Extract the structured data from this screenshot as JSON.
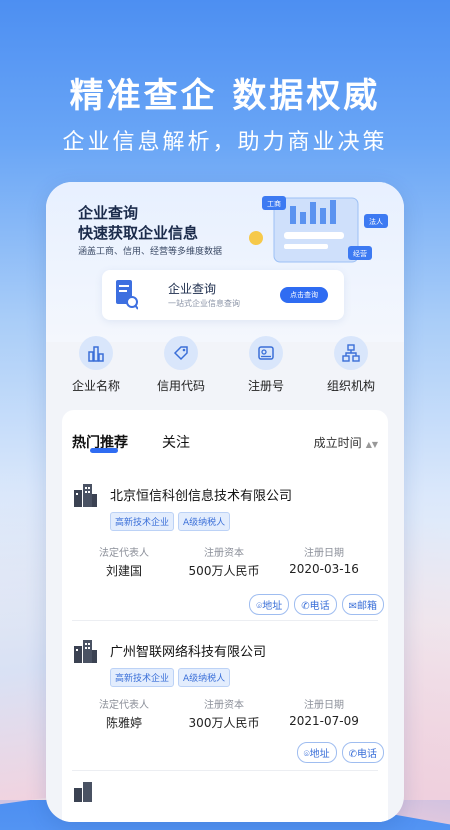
{
  "hero": {
    "title": "精准查企 数据权威",
    "subtitle": "企业信息解析，助力商业决策"
  },
  "banner": {
    "line1": "企业查询",
    "line2": "快速获取企业信息",
    "line3": "涵盖工商、信用、经营等多维度数据",
    "illus_labels": [
      "工商",
      "法人",
      "经营"
    ]
  },
  "search_card": {
    "title": "企业查询",
    "desc": "一站式企业信息查询",
    "button": "点击查询"
  },
  "categories": [
    {
      "label": "企业名称",
      "icon": "building-chart-icon"
    },
    {
      "label": "信用代码",
      "icon": "tag-icon"
    },
    {
      "label": "注册号",
      "icon": "id-card-icon"
    },
    {
      "label": "组织机构",
      "icon": "org-tree-icon"
    }
  ],
  "tabs": {
    "hot": "热门推荐",
    "follow": "关注",
    "sort": "成立时间"
  },
  "fields": {
    "legal": "法定代表人",
    "capital": "注册资本",
    "date": "注册日期"
  },
  "companies": [
    {
      "name": "北京恒信科创信息技术有限公司",
      "tags": [
        "高新技术企业",
        "A级纳税人"
      ],
      "legal": "刘建国",
      "capital": "500万人民币",
      "date": "2020-03-16",
      "actions": [
        "地址",
        "电话",
        "邮箱"
      ]
    },
    {
      "name": "广州智联网络科技有限公司",
      "tags": [
        "高新技术企业",
        "A级纳税人"
      ],
      "legal": "陈雅婷",
      "capital": "300万人民币",
      "date": "2021-07-09",
      "actions": [
        "地址",
        "电话"
      ]
    }
  ],
  "colors": {
    "accent": "#2f6cf2",
    "tag_bg": "#e3edfd"
  }
}
